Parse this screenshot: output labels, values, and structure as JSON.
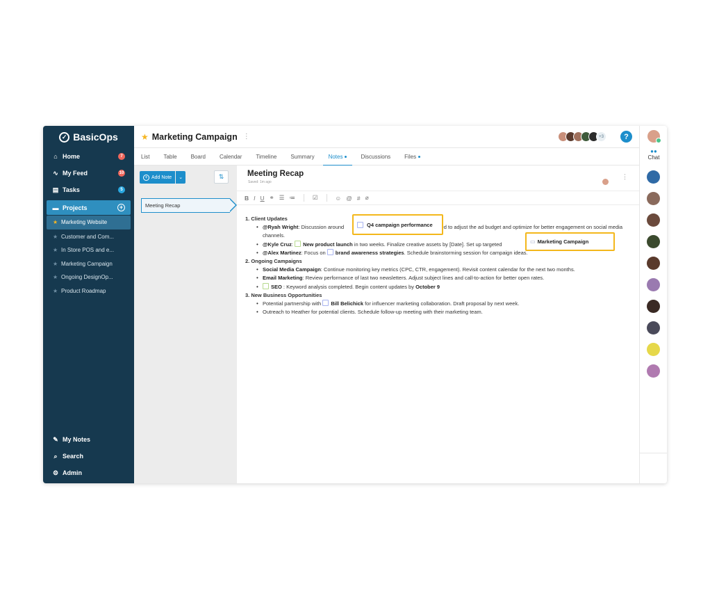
{
  "app": {
    "logo_text": "BasicOps"
  },
  "sidebar": {
    "nav": [
      {
        "label": "Home",
        "icon": "home-icon",
        "badge": "7"
      },
      {
        "label": "My Feed",
        "icon": "pulse-icon",
        "badge": "10"
      },
      {
        "label": "Tasks",
        "icon": "clipboard-icon",
        "badge": "5"
      }
    ],
    "projects_label": "Projects",
    "projects": [
      "Marketing Website",
      "Customer and Com...",
      "In Store POS and e...",
      "Marketing Campaign",
      "Ongoing DesignOp...",
      "Product Roadmap"
    ],
    "bottom": [
      {
        "label": "My Notes",
        "icon": "pencil-icon"
      },
      {
        "label": "Search",
        "icon": "search-icon"
      },
      {
        "label": "Admin",
        "icon": "gear-icon"
      }
    ]
  },
  "header": {
    "title": "Marketing Campaign",
    "avatar_overflow": "+3"
  },
  "tabs": [
    "List",
    "Table",
    "Board",
    "Calendar",
    "Timeline",
    "Summary",
    "Notes",
    "Discussions",
    "Files"
  ],
  "notes_pane": {
    "add_note_label": "Add Note",
    "items": [
      "Meeting Recap"
    ]
  },
  "editor": {
    "title": "Meeting Recap",
    "saved": "Saved: 1m ago",
    "sections": {
      "s1_title": "1. Client Updates",
      "s1_b1_mention": "@Ryah Wright",
      "s1_b1_pre": ": Discussion around",
      "s1_b1_post": "need to adjust the ad budget and optimize for better engagement on social media channels.",
      "s1_b2_mention": "@Kyle Cruz",
      "s1_b2_link": "New product launch",
      "s1_b2_post": " in two weeks. Finalize creative assets by [Date]. Set up targeted",
      "s1_b3_mention": "@Alex Martinez",
      "s1_b3_pre": ": Focus on",
      "s1_b3_link": "brand awareness strategies",
      "s1_b3_post": ". Schedule brainstorming session for campaign ideas.",
      "s2_title": "2. Ongoing Campaigns",
      "s2_b1_label": "Social Media Campaign",
      "s2_b1_text": ": Continue monitoring key metrics (CPC, CTR, engagement). Revisit content calendar for the next two months.",
      "s2_b2_label": "Email Marketing",
      "s2_b2_text": ": Review performance of last two newsletters. Adjust subject lines and call-to-action for better open rates.",
      "s2_b3_label": "SEO",
      "s2_b3_text": " : Keyword analysis completed. Begin content updates by",
      "s2_b3_date": "October 9",
      "s3_title": "3. New Business Opportunities",
      "s3_b1_pre": "Potential partnership with",
      "s3_b1_link": "Bill Belichick",
      "s3_b1_post": " for influencer marketing collaboration. Draft proposal by next week.",
      "s3_b2_text": "Outreach to Heather for potential clients. Schedule follow-up meeting with their marketing team."
    },
    "highlight_task": "Q4 campaign performance",
    "highlight_project": "Marketing Campaign"
  },
  "rail": {
    "chat_label": "Chat"
  },
  "colors": {
    "sidebar_bg": "#16394f",
    "accent": "#1d8ecb",
    "highlight": "#f3b71b",
    "star": "#f5b623",
    "badge": "#f0675c"
  }
}
